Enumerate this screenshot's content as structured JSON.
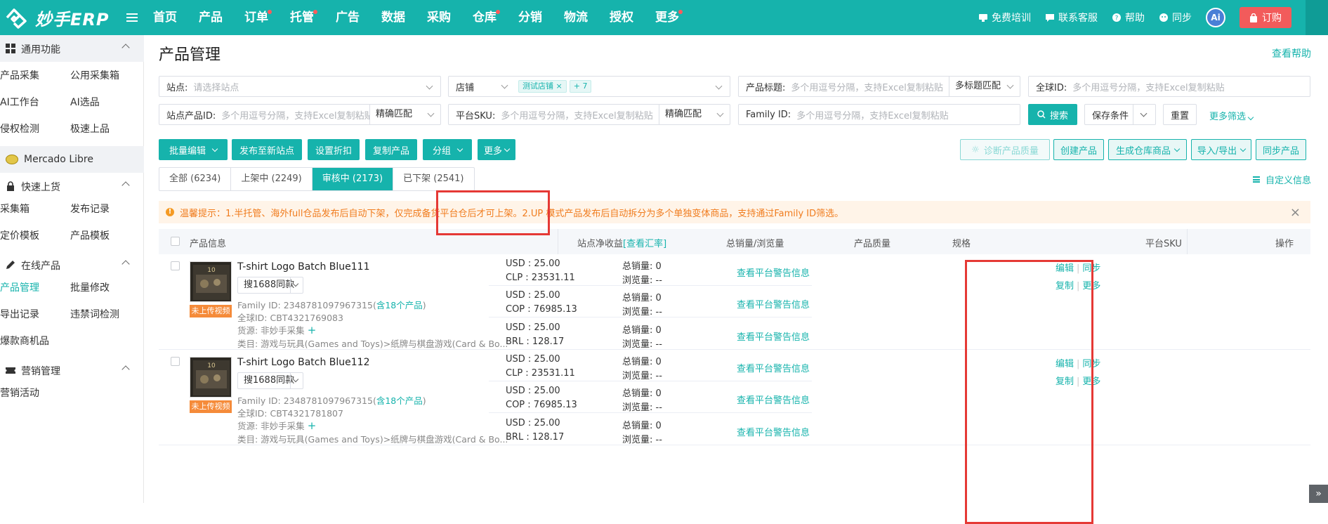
{
  "header": {
    "logo_text": "妙手ERP",
    "nav": [
      {
        "label": "首页",
        "dot": false
      },
      {
        "label": "产品",
        "dot": false
      },
      {
        "label": "订单",
        "dot": true
      },
      {
        "label": "托管",
        "dot": true
      },
      {
        "label": "广告",
        "dot": false
      },
      {
        "label": "数据",
        "dot": false
      },
      {
        "label": "采购",
        "dot": false
      },
      {
        "label": "仓库",
        "dot": true
      },
      {
        "label": "分销",
        "dot": false
      },
      {
        "label": "物流",
        "dot": false
      },
      {
        "label": "授权",
        "dot": false
      },
      {
        "label": "更多",
        "dot": true
      }
    ],
    "right": {
      "training": "免费培训",
      "service": "联系客服",
      "help": "帮助",
      "sync": "同步",
      "ai": "Ai",
      "order": "订购"
    }
  },
  "sidebar": {
    "groups": {
      "common": "通用功能",
      "quick": "快速上货",
      "online": "在线产品",
      "marketing": "营销管理"
    },
    "items": {
      "collect": "产品采集",
      "public_box": "公用采集箱",
      "ai_bench": "AI工作台",
      "ai_select": "AI选品",
      "infringe": "侵权检测",
      "fast_list": "极速上品",
      "mercado": "Mercado Libre",
      "box": "采集箱",
      "publish_log": "发布记录",
      "price_tpl": "定价模板",
      "prod_tpl": "产品模板",
      "prod_mgmt": "产品管理",
      "batch_edit": "批量修改",
      "export_log": "导出记录",
      "banned": "违禁词检测",
      "hot": "爆款商机品",
      "campaign": "营销活动"
    }
  },
  "page": {
    "title": "产品管理",
    "help_link": "查看帮助"
  },
  "filters": {
    "site_label": "站点:",
    "site_placeholder": "请选择站点",
    "shop_label": "店铺",
    "shop_tag": "测试店铺",
    "shop_more": "+ 7",
    "title_label": "产品标题:",
    "title_placeholder": "多个用逗号分隔，支持Excel复制粘贴",
    "title_match": "多标题匹配",
    "global_label": "全球ID:",
    "global_placeholder": "多个用逗号分隔，支持Excel复制粘贴",
    "site_pid_label": "站点产品ID:",
    "site_pid_placeholder": "多个用逗号分隔，支持Excel复制粘贴",
    "exact_match": "精确匹配",
    "sku_label": "平台SKU:",
    "sku_placeholder": "多个用逗号分隔，支持Excel复制粘贴",
    "family_label": "Family ID:",
    "family_placeholder": "多个用逗号分隔，支持Excel复制粘贴",
    "search": "搜索",
    "save": "保存条件",
    "reset": "重置",
    "more": "更多筛选"
  },
  "toolbar": {
    "batch_edit": "批量编辑",
    "publish_new": "发布至新站点",
    "discount": "设置折扣",
    "copy": "复制产品",
    "group": "分组",
    "more": "更多",
    "diagnose": "诊断产品质量",
    "create": "创建产品",
    "gen_wh": "生成仓库商品",
    "import_export": "导入/导出",
    "sync": "同步产品"
  },
  "tabs": [
    {
      "label": "全部 (6234)",
      "active": false
    },
    {
      "label": "上架中 (2249)",
      "active": false
    },
    {
      "label": "审核中 (2173)",
      "active": true
    },
    {
      "label": "已下架 (2541)",
      "active": false
    }
  ],
  "custom_info": "自定义信息",
  "notice": "温馨提示：1.半托管、海外full仓品发布后自动下架，仅完成备货平台仓后才可上架。2.UP 模式产品发布后自动拆分为多个单独变体商品，支持通过Family ID筛选。",
  "table": {
    "headers": {
      "info": "产品信息",
      "profit": "站点净收益",
      "rate_link": "[查看汇率]",
      "sales": "总销量/浏览量",
      "quality": "产品质量",
      "spec": "规格",
      "sku": "平台SKU",
      "ops": "操作"
    },
    "rows": [
      {
        "title": "T-shirt Logo Batch Blue111",
        "same_btn": "搜1688同款",
        "video_badge": "未上传视频",
        "family_label": "Family ID:  2348781097967315(",
        "family_link": "含18个产品",
        "family_end": ")",
        "global_id": "全球ID:  CBT4321769083",
        "source": "货源:  非妙手采集",
        "category": "类目:  游戏与玩具(Games and Toys)>纸牌与棋盘游戏(Card & Bo...",
        "sites": [
          {
            "usd": "USD : 25.00",
            "local": "CLP : 23531.11",
            "sales": "总销量:  0",
            "views": "浏览量:  --",
            "quality": "查看平台警告信息"
          },
          {
            "usd": "USD : 25.00",
            "local": "COP : 76985.13",
            "sales": "总销量:  0",
            "views": "浏览量:  --",
            "quality": "查看平台警告信息"
          },
          {
            "usd": "USD : 25.00",
            "local": "BRL : 128.17",
            "sales": "总销量:  0",
            "views": "浏览量:  --",
            "quality": "查看平台警告信息"
          }
        ]
      },
      {
        "title": "T-shirt Logo Batch Blue112",
        "same_btn": "搜1688同款",
        "video_badge": "未上传视频",
        "family_label": "Family ID:  2348781097967315(",
        "family_link": "含18个产品",
        "family_end": ")",
        "global_id": "全球ID:  CBT4321781807",
        "source": "货源:  非妙手采集",
        "category": "类目:  游戏与玩具(Games and Toys)>纸牌与棋盘游戏(Card & Bo...",
        "sites": [
          {
            "usd": "USD : 25.00",
            "local": "CLP : 23531.11",
            "sales": "总销量:  0",
            "views": "浏览量:  --",
            "quality": "查看平台警告信息"
          },
          {
            "usd": "USD : 25.00",
            "local": "COP : 76985.13",
            "sales": "总销量:  0",
            "views": "浏览量:  --",
            "quality": "查看平台警告信息"
          },
          {
            "usd": "USD : 25.00",
            "local": "BRL : 128.17",
            "sales": "总销量:  0",
            "views": "浏览量:  --",
            "quality": "查看平台警告信息"
          }
        ]
      }
    ],
    "ops": {
      "edit": "编辑",
      "sync": "同步",
      "copy": "复制",
      "more": "更多"
    }
  },
  "colors": {
    "primary": "#16b3ac",
    "highlight": "#e53935",
    "notice_text": "#f07c1e"
  }
}
